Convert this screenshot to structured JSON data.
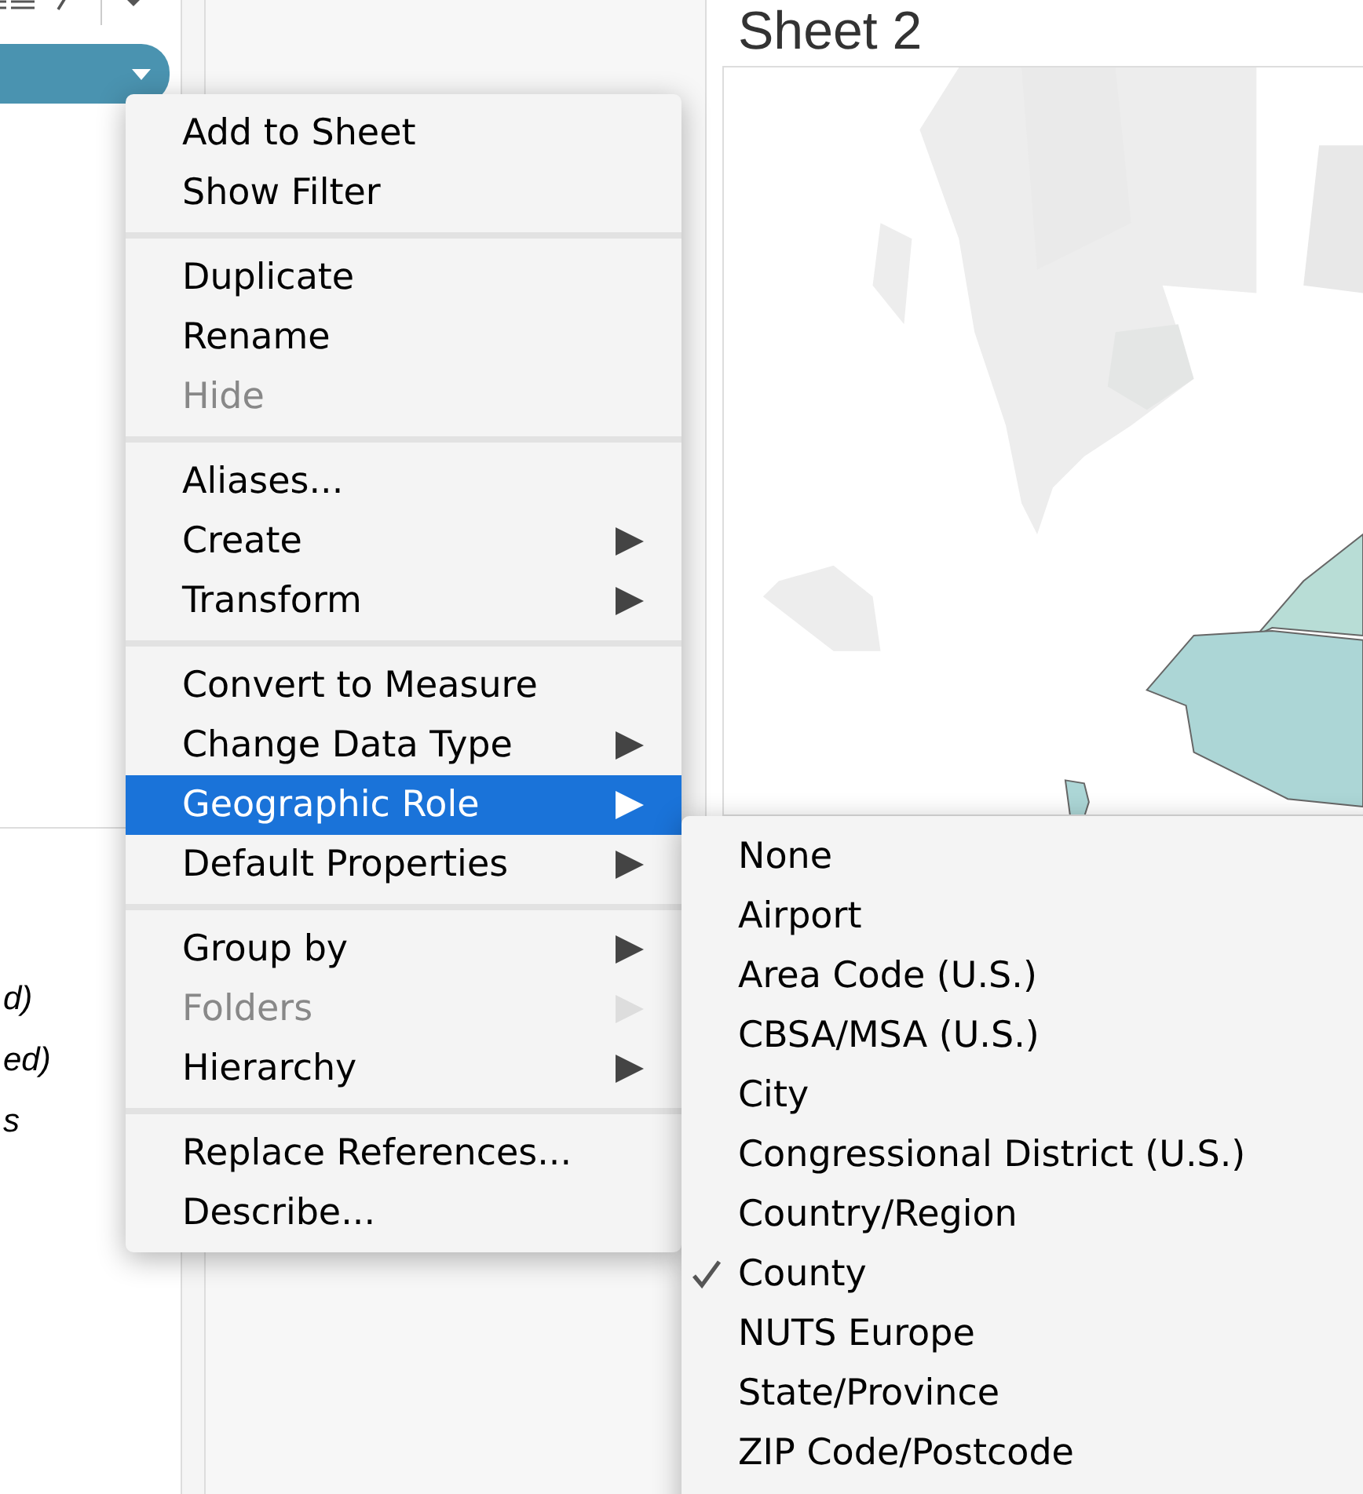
{
  "sheet": {
    "title": "Sheet 2"
  },
  "left_pane": {
    "fragments": [
      "d)",
      "ed)",
      "s"
    ]
  },
  "context_menu": {
    "sections": [
      {
        "items": [
          {
            "label": "Add to Sheet",
            "disabled": false,
            "submenu": false,
            "selected": false
          },
          {
            "label": "Show Filter",
            "disabled": false,
            "submenu": false,
            "selected": false
          }
        ]
      },
      {
        "items": [
          {
            "label": "Duplicate",
            "disabled": false,
            "submenu": false,
            "selected": false
          },
          {
            "label": "Rename",
            "disabled": false,
            "submenu": false,
            "selected": false
          },
          {
            "label": "Hide",
            "disabled": true,
            "submenu": false,
            "selected": false
          }
        ]
      },
      {
        "items": [
          {
            "label": "Aliases...",
            "disabled": false,
            "submenu": false,
            "selected": false
          },
          {
            "label": "Create",
            "disabled": false,
            "submenu": true,
            "selected": false
          },
          {
            "label": "Transform",
            "disabled": false,
            "submenu": true,
            "selected": false
          }
        ]
      },
      {
        "items": [
          {
            "label": "Convert to Measure",
            "disabled": false,
            "submenu": false,
            "selected": false
          },
          {
            "label": "Change Data Type",
            "disabled": false,
            "submenu": true,
            "selected": false
          },
          {
            "label": "Geographic Role",
            "disabled": false,
            "submenu": true,
            "selected": true
          },
          {
            "label": "Default Properties",
            "disabled": false,
            "submenu": true,
            "selected": false
          }
        ]
      },
      {
        "items": [
          {
            "label": "Group by",
            "disabled": false,
            "submenu": true,
            "selected": false
          },
          {
            "label": "Folders",
            "disabled": true,
            "submenu": true,
            "selected": false
          },
          {
            "label": "Hierarchy",
            "disabled": false,
            "submenu": true,
            "selected": false
          }
        ]
      },
      {
        "items": [
          {
            "label": "Replace References...",
            "disabled": false,
            "submenu": false,
            "selected": false
          },
          {
            "label": "Describe...",
            "disabled": false,
            "submenu": false,
            "selected": false
          }
        ]
      }
    ]
  },
  "submenu": {
    "items": [
      {
        "label": "None",
        "checked": false
      },
      {
        "label": "Airport",
        "checked": false
      },
      {
        "label": "Area Code (U.S.)",
        "checked": false
      },
      {
        "label": "CBSA/MSA (U.S.)",
        "checked": false
      },
      {
        "label": "City",
        "checked": false
      },
      {
        "label": "Congressional District (U.S.)",
        "checked": false
      },
      {
        "label": "Country/Region",
        "checked": false
      },
      {
        "label": "County",
        "checked": true
      },
      {
        "label": "NUTS Europe",
        "checked": false
      },
      {
        "label": "State/Province",
        "checked": false
      },
      {
        "label": "ZIP Code/Postcode",
        "checked": false
      }
    ]
  }
}
